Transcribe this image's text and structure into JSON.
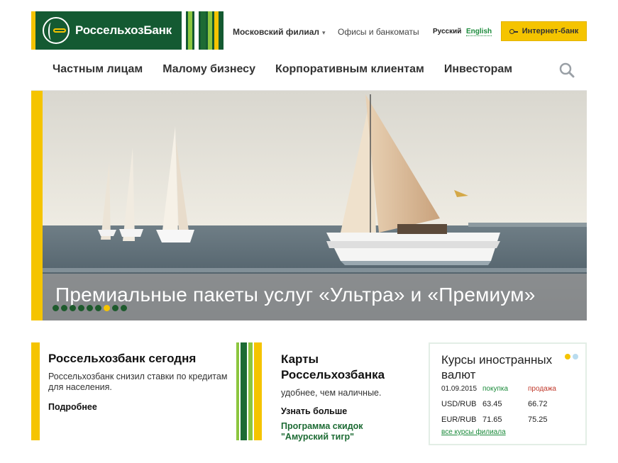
{
  "header": {
    "logo_text": "РоссельхозБанк",
    "branch": "Московский филиал",
    "offices": "Офисы и банкоматы",
    "lang_ru": "Русский",
    "lang_en": "English",
    "internet_bank": "Интернет-банк"
  },
  "nav": {
    "items": [
      "Частным лицам",
      "Малому бизнесу",
      "Корпоративным клиентам",
      "Инвесторам"
    ]
  },
  "hero": {
    "caption": "Премиальные пакеты услуг «Ультра» и «Премиум»",
    "slide_count": 9,
    "active_slide": 7
  },
  "today": {
    "title": "Россельхозбанк сегодня",
    "text": "Россельхозбанк снизил ставки по кредитам для населения.",
    "link": "Подробнее"
  },
  "cards": {
    "title": "Карты Россельхозбанка",
    "text": "удобнее, чем наличные.",
    "link": "Узнать больше",
    "promo": "Программа скидок \"Амурский тигр\""
  },
  "rates": {
    "title": "Курсы иностранных валют",
    "date": "01.09.2015",
    "buy_label": "покупка",
    "sell_label": "продажа",
    "rows": [
      {
        "pair": "USD/RUB",
        "buy": "63.45",
        "sell": "66.72"
      },
      {
        "pair": "EUR/RUB",
        "buy": "71.65",
        "sell": "75.25"
      }
    ],
    "all_link": "все курсы филиала"
  },
  "colors": {
    "brand_green": "#145a32",
    "accent_yellow": "#f5c400",
    "link_green": "#1a8a3a",
    "sell_red": "#c0392b"
  }
}
